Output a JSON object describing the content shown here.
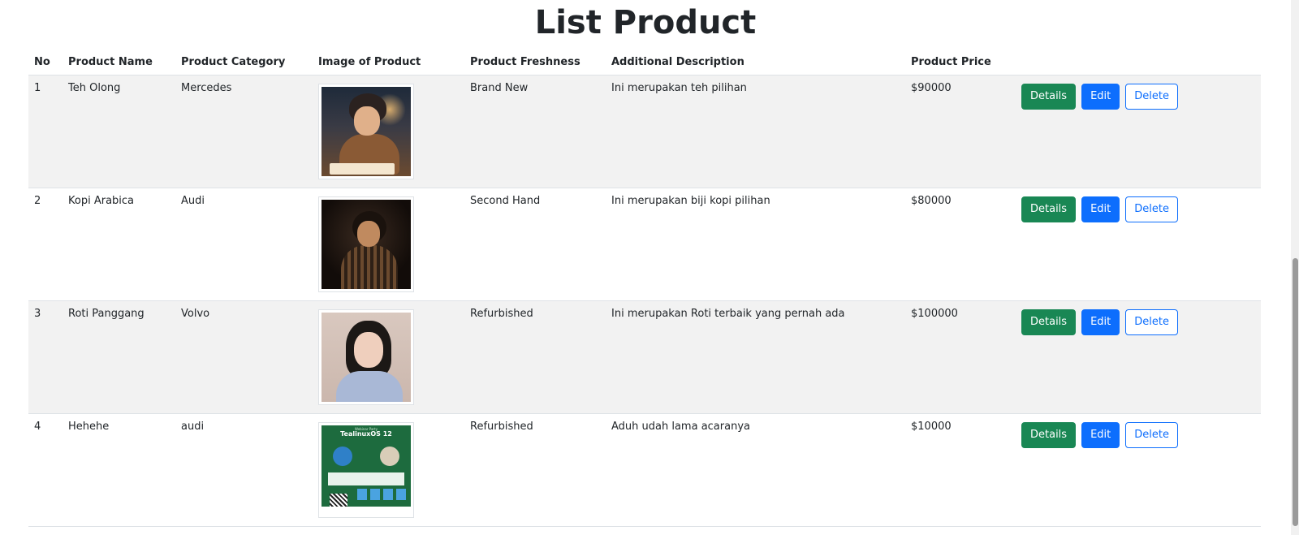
{
  "page": {
    "title": "List Product"
  },
  "table": {
    "headers": [
      "No",
      "Product Name",
      "Product Category",
      "Image of Product",
      "Product Freshness",
      "Additional Description",
      "Product Price",
      ""
    ],
    "rows": [
      {
        "no": "1",
        "name": "Teh Olong",
        "category": "Mercedes",
        "image": "person-studying-night-image",
        "freshness": "Brand New",
        "description": "Ini merupakan teh pilihan",
        "price": "$90000"
      },
      {
        "no": "2",
        "name": "Kopi Arabica",
        "category": "Audi",
        "image": "person-dark-portrait-image",
        "freshness": "Second Hand",
        "description": "Ini merupakan biji kopi pilihan",
        "price": "$80000"
      },
      {
        "no": "3",
        "name": "Roti Panggang",
        "category": "Volvo",
        "image": "person-light-portrait-image",
        "freshness": "Refurbished",
        "description": "Ini merupakan Roti terbaik yang pernah ada",
        "price": "$100000"
      },
      {
        "no": "4",
        "name": "Hehehe",
        "category": "audi",
        "image": "event-poster-image",
        "freshness": "Refurbished",
        "description": "Aduh udah lama acaranya",
        "price": "$10000"
      }
    ]
  },
  "actions": {
    "details_label": "Details",
    "edit_label": "Edit",
    "delete_label": "Delete"
  },
  "poster": {
    "subtitle": "Webinar Party",
    "title": "TealinuxOS 12"
  },
  "colors": {
    "success": "#198754",
    "primary": "#0d6efd",
    "stripe": "#f2f2f2"
  }
}
